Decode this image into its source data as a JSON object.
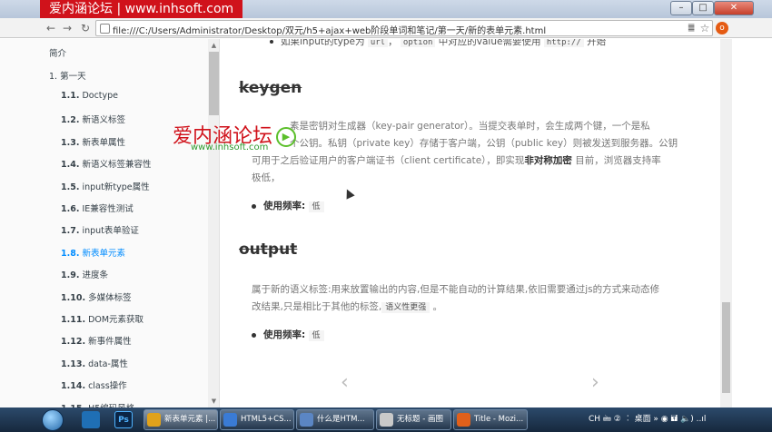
{
  "window": {
    "banner": "爱内涵论坛 | www.inhsoft.com",
    "controls": {
      "minimize": "–",
      "maximize": "□",
      "close": "✕"
    }
  },
  "browser": {
    "back_icon": "back-arrow-icon",
    "forward_icon": "forward-arrow-icon",
    "reload_icon": "reload-icon",
    "url": "file:///C:/Users/Administrator/Desktop/双元/h5+ajax+web阶段单词和笔记/第一天/新的表单元素.html",
    "star_icon": "☆"
  },
  "sidebar": {
    "intro": "简介",
    "chapter": "1. 第一天",
    "items": [
      {
        "num": "1.1.",
        "label": "Doctype"
      },
      {
        "num": "1.2.",
        "label": "新语义标签"
      },
      {
        "num": "1.3.",
        "label": "新表单属性"
      },
      {
        "num": "1.4.",
        "label": "新语义标签兼容性"
      },
      {
        "num": "1.5.",
        "label": "input新type属性"
      },
      {
        "num": "1.6.",
        "label": "IE兼容性测试"
      },
      {
        "num": "1.7.",
        "label": "input表单验证"
      },
      {
        "num": "1.8.",
        "label": "新表单元素",
        "active": true
      },
      {
        "num": "1.9.",
        "label": "进度条"
      },
      {
        "num": "1.10.",
        "label": "多媒体标签"
      },
      {
        "num": "1.11.",
        "label": "DOM元素获取"
      },
      {
        "num": "1.12.",
        "label": "新事件属性"
      },
      {
        "num": "1.13.",
        "label": "data-属性"
      },
      {
        "num": "1.14.",
        "label": "class操作"
      },
      {
        "num": "1.15.",
        "label": "H5编码风格"
      }
    ]
  },
  "main": {
    "top_line_prefix": "如果input的type为",
    "top_code1": "url",
    "top_sep": "，",
    "top_code2": "option",
    "top_line_mid": "中对应的value需要使用",
    "top_code3": "http://",
    "top_line_end": "开始",
    "keygen_heading": "keygen",
    "keygen_para_1": "素是密钥对生成器（key-pair generator）。当提交表单时，会生成两个键，一个是私",
    "keygen_para_2": "个公钥。私钥（private key）存储于客户端，公钥（public key）则被发送到服务器。公钥",
    "keygen_para_3_pre": "可用于之后验证用户的客户端证书（client certificate），即实现",
    "keygen_para_3_bold": "非对称加密",
    "keygen_para_3_post": "目前，浏览器支持率",
    "keygen_para_4": "极低，",
    "freq_label": "使用频率:",
    "freq_value_1": "低",
    "output_heading": "output",
    "output_para_1": "属于新的语义标签:用来放置输出的内容,但是不能自动的计算结果,依旧需要通过js的方式来动态修",
    "output_para_2_pre": "改结果,只是相比于其他的标签,",
    "output_para_2_tag": "语义性更强",
    "output_para_2_post": "。",
    "freq_value_2": "低",
    "prev_arrow": "‹",
    "next_arrow": "›"
  },
  "watermark": {
    "logo_text": "爱内涵论坛",
    "play": "▶",
    "url": "www.inhsoft.com"
  },
  "taskbar": {
    "quick": [
      "",
      "Ps"
    ],
    "tasks": [
      {
        "label": "新表单元素 |...",
        "active": true
      },
      {
        "label": "HTML5+CS..."
      },
      {
        "label": "什么是HTM..."
      },
      {
        "label": "无标题 - 画图"
      },
      {
        "label": "Title - Mozi..."
      }
    ],
    "tray_text": "CH  🖮 ②  ︰  桌面  »  ◉  🖬  🔈)  ..ıl"
  }
}
